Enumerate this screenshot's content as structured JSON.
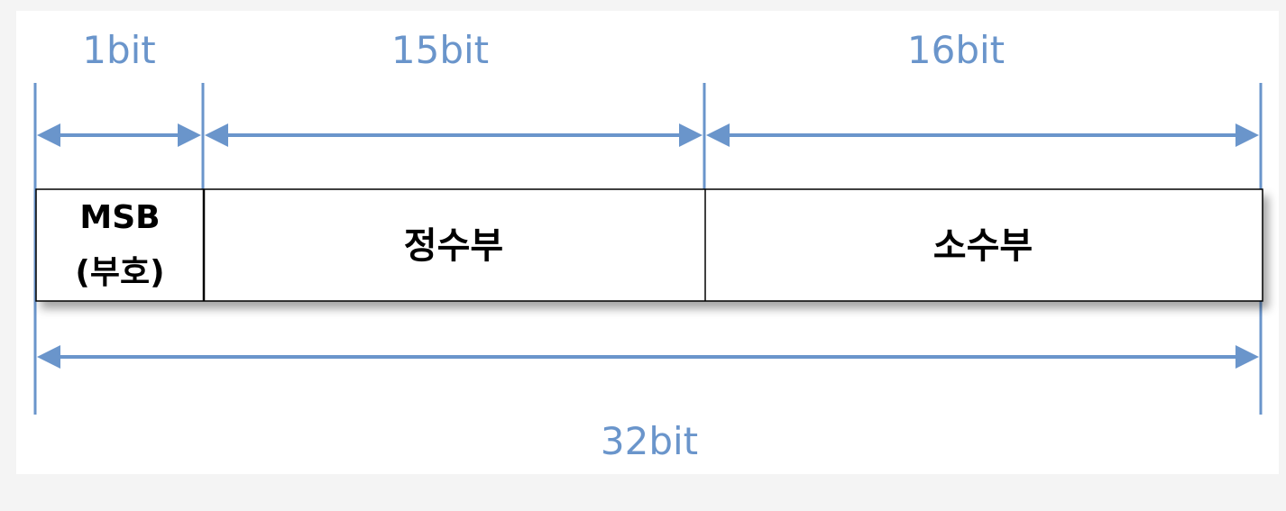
{
  "colors": {
    "background": "#f4f4f4",
    "panel": "#ffffff",
    "dimension_blue": "#6a95cb",
    "box_border": "#000000"
  },
  "dimensions": {
    "sign_bits": "1bit",
    "integer_bits": "15bit",
    "fraction_bits": "16bit",
    "total_bits": "32bit"
  },
  "fields": {
    "sign_line1": "MSB",
    "sign_line2": "(부호)",
    "integer": "정수부",
    "fraction": "소수부"
  }
}
